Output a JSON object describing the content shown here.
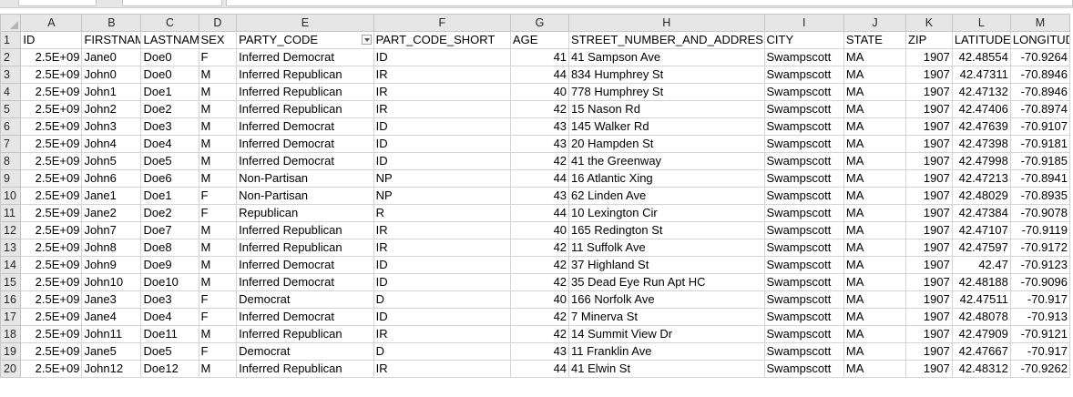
{
  "columns": [
    "A",
    "B",
    "C",
    "D",
    "E",
    "F",
    "G",
    "H",
    "I",
    "J",
    "K",
    "L",
    "M"
  ],
  "headers": [
    "ID",
    "FIRSTNAME",
    "LASTNAME",
    "SEX",
    "PARTY_CODE",
    "PART_CODE_SHORT",
    "AGE",
    "STREET_NUMBER_AND_ADDRESS",
    "CITY",
    "STATE",
    "ZIP",
    "LATITUDE",
    "LONGITUDE"
  ],
  "filter_column_index": 4,
  "rows": [
    [
      "2.5E+09",
      "Jane0",
      "Doe0",
      "F",
      "Inferred Democrat",
      "ID",
      "41",
      "41 Sampson Ave",
      "Swampscott",
      "MA",
      "1907",
      "42.48554",
      "-70.9264"
    ],
    [
      "2.5E+09",
      "John0",
      "Doe0",
      "M",
      "Inferred Republican",
      "IR",
      "44",
      "834 Humphrey St",
      "Swampscott",
      "MA",
      "1907",
      "42.47311",
      "-70.8946"
    ],
    [
      "2.5E+09",
      "John1",
      "Doe1",
      "M",
      "Inferred Republican",
      "IR",
      "40",
      "778 Humphrey St",
      "Swampscott",
      "MA",
      "1907",
      "42.47132",
      "-70.8946"
    ],
    [
      "2.5E+09",
      "John2",
      "Doe2",
      "M",
      "Inferred Republican",
      "IR",
      "42",
      "15 Nason Rd",
      "Swampscott",
      "MA",
      "1907",
      "42.47406",
      "-70.8974"
    ],
    [
      "2.5E+09",
      "John3",
      "Doe3",
      "M",
      "Inferred Democrat",
      "ID",
      "43",
      "145 Walker Rd",
      "Swampscott",
      "MA",
      "1907",
      "42.47639",
      "-70.9107"
    ],
    [
      "2.5E+09",
      "John4",
      "Doe4",
      "M",
      "Inferred Democrat",
      "ID",
      "43",
      "20 Hampden St",
      "Swampscott",
      "MA",
      "1907",
      "42.47398",
      "-70.9181"
    ],
    [
      "2.5E+09",
      "John5",
      "Doe5",
      "M",
      "Inferred Democrat",
      "ID",
      "42",
      "41 the Greenway",
      "Swampscott",
      "MA",
      "1907",
      "42.47998",
      "-70.9185"
    ],
    [
      "2.5E+09",
      "John6",
      "Doe6",
      "M",
      "Non-Partisan",
      "NP",
      "44",
      "16 Atlantic Xing",
      "Swampscott",
      "MA",
      "1907",
      "42.47213",
      "-70.8941"
    ],
    [
      "2.5E+09",
      "Jane1",
      "Doe1",
      "F",
      "Non-Partisan",
      "NP",
      "43",
      "62 Linden Ave",
      "Swampscott",
      "MA",
      "1907",
      "42.48029",
      "-70.8935"
    ],
    [
      "2.5E+09",
      "Jane2",
      "Doe2",
      "F",
      "Republican",
      "R",
      "44",
      "10 Lexington Cir",
      "Swampscott",
      "MA",
      "1907",
      "42.47384",
      "-70.9078"
    ],
    [
      "2.5E+09",
      "John7",
      "Doe7",
      "M",
      "Inferred Republican",
      "IR",
      "40",
      "165 Redington St",
      "Swampscott",
      "MA",
      "1907",
      "42.47107",
      "-70.9119"
    ],
    [
      "2.5E+09",
      "John8",
      "Doe8",
      "M",
      "Inferred Republican",
      "IR",
      "42",
      "11 Suffolk Ave",
      "Swampscott",
      "MA",
      "1907",
      "42.47597",
      "-70.9172"
    ],
    [
      "2.5E+09",
      "John9",
      "Doe9",
      "M",
      "Inferred Democrat",
      "ID",
      "42",
      "37 Highland St",
      "Swampscott",
      "MA",
      "1907",
      "42.47",
      "-70.9123"
    ],
    [
      "2.5E+09",
      "John10",
      "Doe10",
      "M",
      "Inferred Democrat",
      "ID",
      "42",
      "35 Dead Eye Run Apt HC",
      "Swampscott",
      "MA",
      "1907",
      "42.48188",
      "-70.9096"
    ],
    [
      "2.5E+09",
      "Jane3",
      "Doe3",
      "F",
      "Democrat",
      "D",
      "40",
      "166 Norfolk Ave",
      "Swampscott",
      "MA",
      "1907",
      "42.47511",
      "-70.917"
    ],
    [
      "2.5E+09",
      "Jane4",
      "Doe4",
      "F",
      "Inferred Democrat",
      "ID",
      "42",
      "7 Minerva St",
      "Swampscott",
      "MA",
      "1907",
      "42.48078",
      "-70.913"
    ],
    [
      "2.5E+09",
      "John11",
      "Doe11",
      "M",
      "Inferred Republican",
      "IR",
      "42",
      "14 Summit View Dr",
      "Swampscott",
      "MA",
      "1907",
      "42.47909",
      "-70.9121"
    ],
    [
      "2.5E+09",
      "Jane5",
      "Doe5",
      "F",
      "Democrat",
      "D",
      "43",
      "11 Franklin Ave",
      "Swampscott",
      "MA",
      "1907",
      "42.47667",
      "-70.917"
    ],
    [
      "2.5E+09",
      "John12",
      "Doe12",
      "M",
      "Inferred Republican",
      "IR",
      "44",
      "41 Elwin St",
      "Swampscott",
      "MA",
      "1907",
      "42.48312",
      "-70.9262"
    ]
  ]
}
